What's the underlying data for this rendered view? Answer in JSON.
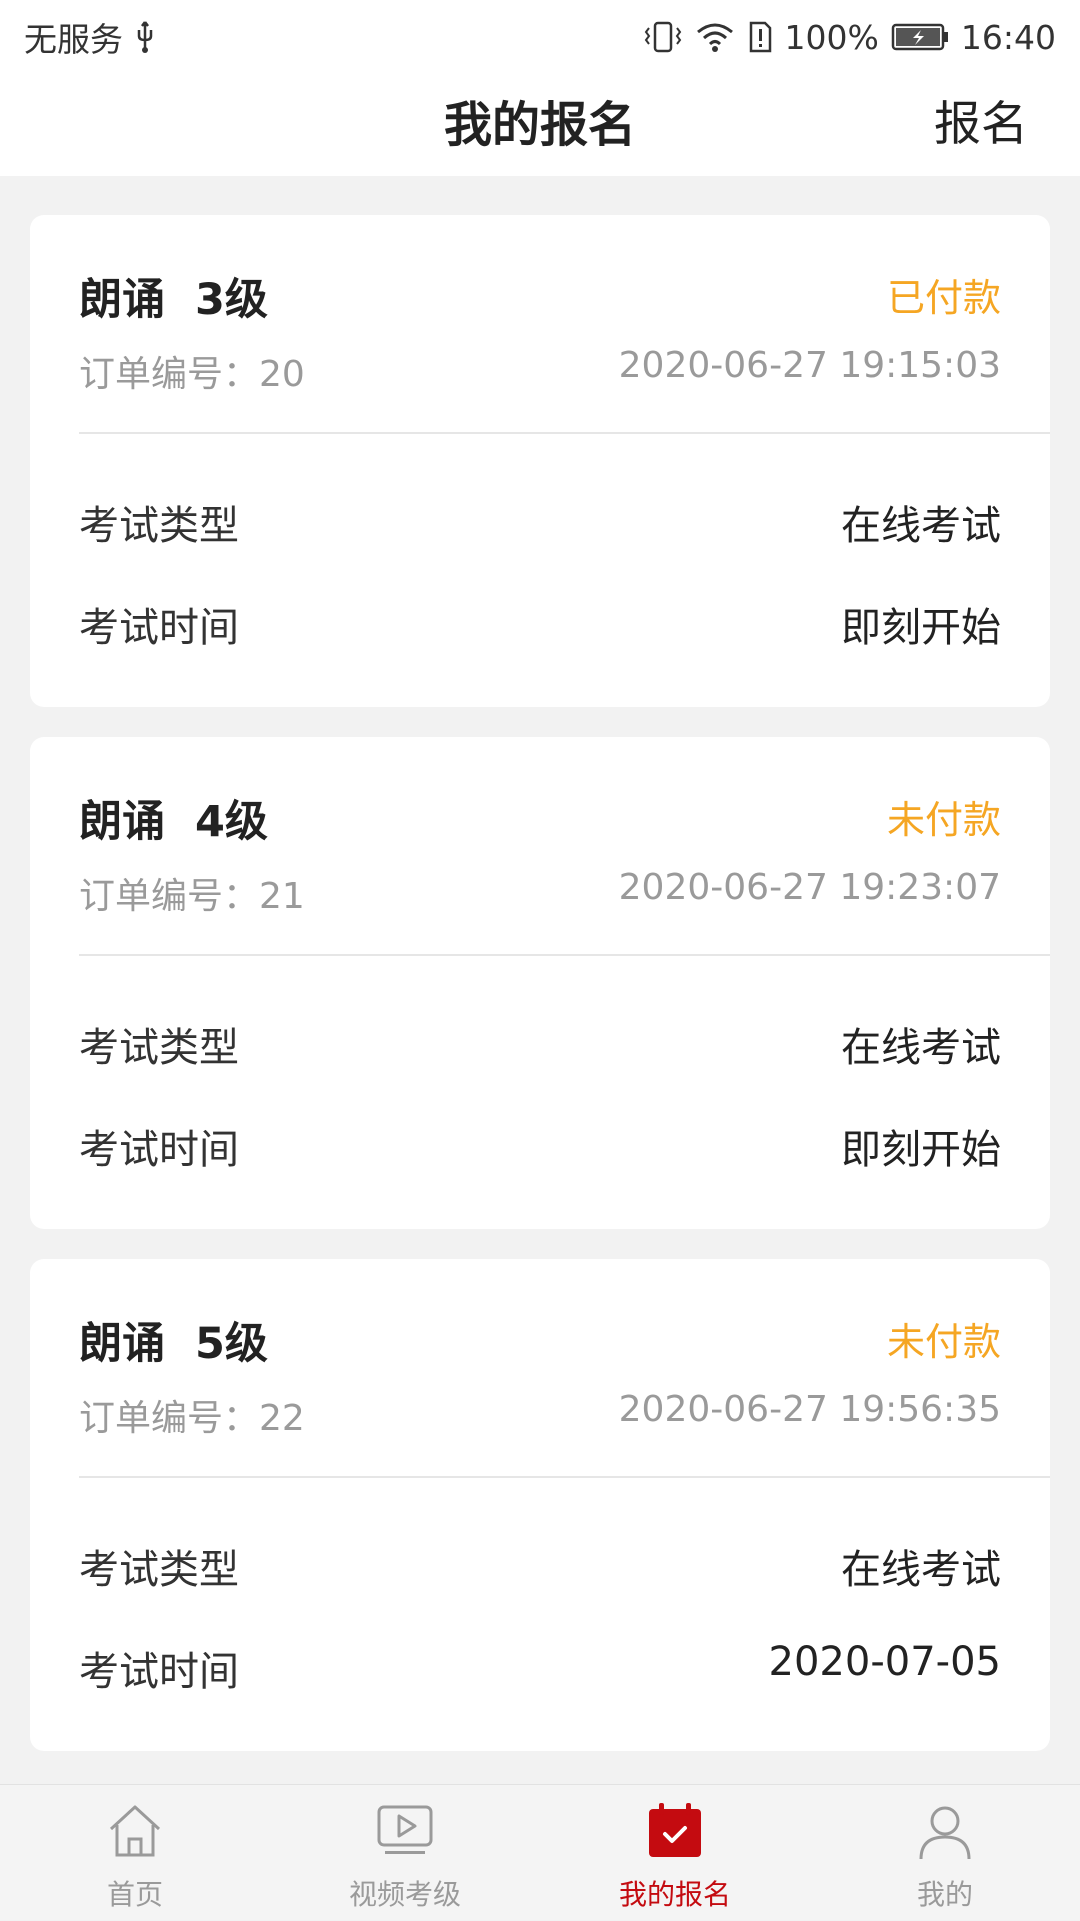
{
  "status_bar": {
    "carrier": "无服务",
    "battery": "100%",
    "time": "16:40"
  },
  "header": {
    "title": "我的报名",
    "action": "报名"
  },
  "orders": [
    {
      "title": "朗诵  3级",
      "status": "已付款",
      "order_no": "订单编号：20",
      "order_time": "2020-06-27 19:15:03",
      "type_label": "考试类型",
      "type_value": "在线考试",
      "time_label": "考试时间",
      "time_value": "即刻开始"
    },
    {
      "title": "朗诵  4级",
      "status": "未付款",
      "order_no": "订单编号：21",
      "order_time": "2020-06-27 19:23:07",
      "type_label": "考试类型",
      "type_value": "在线考试",
      "time_label": "考试时间",
      "time_value": "即刻开始"
    },
    {
      "title": "朗诵  5级",
      "status": "未付款",
      "order_no": "订单编号：22",
      "order_time": "2020-06-27 19:56:35",
      "type_label": "考试类型",
      "type_value": "在线考试",
      "time_label": "考试时间",
      "time_value": "2020-07-05"
    }
  ],
  "tabbar": {
    "items": [
      {
        "label": "首页",
        "icon": "home-icon"
      },
      {
        "label": "视频考级",
        "icon": "video-play-icon"
      },
      {
        "label": "我的报名",
        "icon": "calendar-check-icon",
        "active": true
      },
      {
        "label": "我的",
        "icon": "user-icon"
      }
    ]
  },
  "colors": {
    "accent_red": "#c40b10",
    "status_orange": "#f5a623",
    "muted_gray": "#9a9a9a"
  }
}
